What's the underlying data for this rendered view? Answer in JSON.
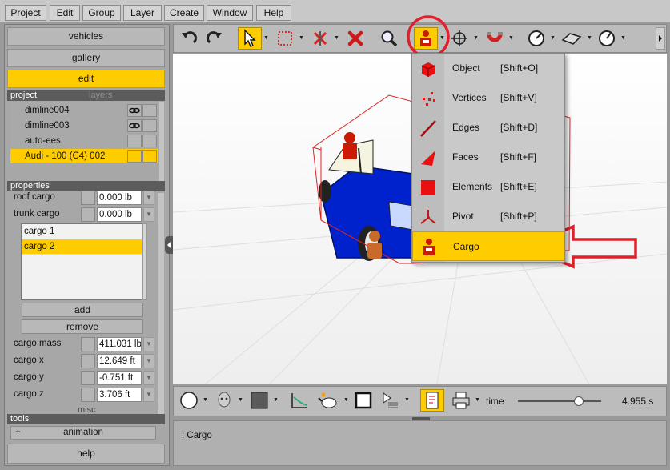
{
  "menubar": [
    "Project",
    "Edit",
    "Group",
    "Layer",
    "Create",
    "Window",
    "Help"
  ],
  "left_panel": {
    "nav": {
      "vehicles": "vehicles",
      "gallery": "gallery",
      "edit": "edit"
    },
    "project_header": "project",
    "layers_tab": "layers",
    "layers": [
      {
        "name": "dimline004",
        "selected": false,
        "has_link": true
      },
      {
        "name": "dimline003",
        "selected": false,
        "has_link": true
      },
      {
        "name": "auto-ees",
        "selected": false,
        "has_link": false
      },
      {
        "name": "Audi - 100 (C4) 002",
        "selected": true,
        "has_link": false
      }
    ],
    "properties_header": "properties",
    "roof_cargo": {
      "label": "roof cargo",
      "value": "0.000 lb"
    },
    "trunk_cargo": {
      "label": "trunk cargo",
      "value": "0.000 lb"
    },
    "cargo_items": [
      {
        "label": "cargo 1",
        "selected": false
      },
      {
        "label": "cargo 2",
        "selected": true
      }
    ],
    "add_label": "add",
    "remove_label": "remove",
    "cargo_mass": {
      "label": "cargo mass",
      "value": "411.031 lb"
    },
    "cargo_x": {
      "label": "cargo x",
      "value": "12.649 ft"
    },
    "cargo_y": {
      "label": "cargo y",
      "value": "-0.751 ft"
    },
    "cargo_z": {
      "label": "cargo z",
      "value": "3.706 ft"
    },
    "misc_label": "misc",
    "tools_header": "tools",
    "animation_plus": "+",
    "animation_label": "animation",
    "help_label": "help"
  },
  "dropdown": {
    "items": [
      {
        "name": "Object",
        "shortcut": "[Shift+O]",
        "icon": "object-cube-icon"
      },
      {
        "name": "Vertices",
        "shortcut": "[Shift+V]",
        "icon": "vertices-icon"
      },
      {
        "name": "Edges",
        "shortcut": "[Shift+D]",
        "icon": "edge-icon"
      },
      {
        "name": "Faces",
        "shortcut": "[Shift+F]",
        "icon": "face-icon"
      },
      {
        "name": "Elements",
        "shortcut": "[Shift+E]",
        "icon": "element-square-icon"
      },
      {
        "name": "Pivot",
        "shortcut": "[Shift+P]",
        "icon": "pivot-axes-icon"
      },
      {
        "name": "Cargo",
        "shortcut": "",
        "icon": "cargo-person-icon",
        "selected": true
      }
    ]
  },
  "bottom_toolbar": {
    "time_label": "time",
    "time_value": "4.955 s",
    "slider_fraction": 0.76
  },
  "console": {
    "text": ": Cargo"
  },
  "colors": {
    "accent": "#ffcc00",
    "annotation": "#e0202a",
    "car_body": "#0022cc",
    "cargo": "#cc1a00"
  }
}
